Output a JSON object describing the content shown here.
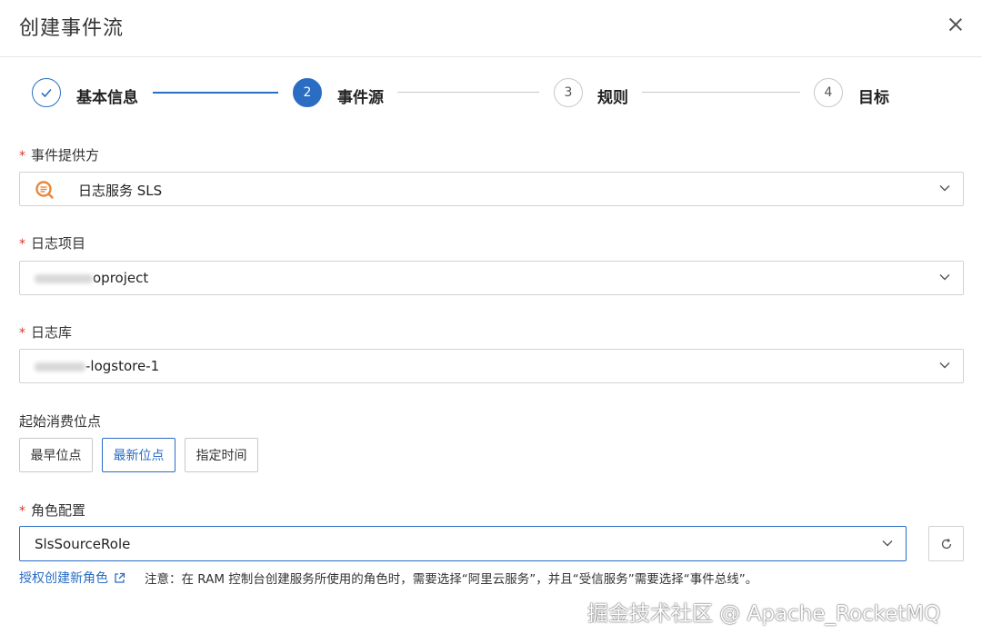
{
  "dialog": {
    "title": "创建事件流"
  },
  "steps": [
    {
      "number": "",
      "label": "基本信息",
      "state": "done"
    },
    {
      "number": "2",
      "label": "事件源",
      "state": "active"
    },
    {
      "number": "3",
      "label": "规则",
      "state": "pending"
    },
    {
      "number": "4",
      "label": "目标",
      "state": "pending"
    }
  ],
  "form": {
    "provider": {
      "label": "事件提供方",
      "required": "*",
      "value": "日志服务 SLS",
      "icon": "sls-icon"
    },
    "project": {
      "label": "日志项目",
      "required": "*",
      "value_suffix": "oproject"
    },
    "logstore": {
      "label": "日志库",
      "required": "*",
      "value_suffix": "-logstore-1"
    },
    "start_position": {
      "label": "起始消费位点",
      "options": [
        "最早位点",
        "最新位点",
        "指定时间"
      ],
      "selected": "最新位点"
    },
    "role": {
      "label": "角色配置",
      "required": "*",
      "value": "SlsSourceRole"
    }
  },
  "help": {
    "link_text": "授权创建新角色",
    "note": "注意：在 RAM 控制台创建服务所使用的角色时，需要选择“阿里云服务”，并且“受信服务”需要选择“事件总线”。"
  },
  "watermark": "掘金技术社区 @ Apache_RocketMQ",
  "colors": {
    "primary": "#2a6dc3",
    "required": "#d9362b",
    "border": "#d2d2d2"
  }
}
